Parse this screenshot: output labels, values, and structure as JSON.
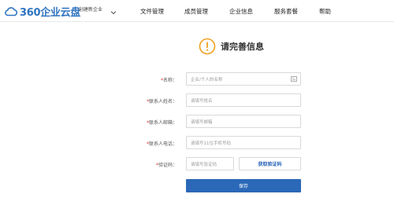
{
  "header": {
    "logo_text": "360企业云盘",
    "org_switch": "创建新企业",
    "nav": [
      {
        "label": "文件管理"
      },
      {
        "label": "成员管理"
      },
      {
        "label": "企业信息"
      },
      {
        "label": "服务套餐"
      },
      {
        "label": "帮助"
      }
    ]
  },
  "page": {
    "title": "请完善信息"
  },
  "form": {
    "fields": [
      {
        "required_mark": "*",
        "label": "名称：",
        "placeholder": "企业/个人的名称"
      },
      {
        "required_mark": "*",
        "label": "联系人姓名：",
        "placeholder": "请填写姓名"
      },
      {
        "required_mark": "*",
        "label": "联系人邮箱：",
        "placeholder": "请填写邮箱"
      },
      {
        "required_mark": "*",
        "label": "联系人电话：",
        "placeholder": "请填写11位手机号码"
      },
      {
        "required_mark": "*",
        "label": "验证码：",
        "placeholder": "请填写验证码"
      }
    ],
    "get_code_label": "获取验证码",
    "save_label": "保存"
  },
  "colors": {
    "brand": "#2f74c0",
    "primary_button": "#2b68b8",
    "warning": "#f0a020",
    "required": "#e03030"
  },
  "icons": {
    "logo": "cloud-icon",
    "org_switch": "chevron-down-icon",
    "title": "warning-icon",
    "name_field": "id-card-icon"
  }
}
